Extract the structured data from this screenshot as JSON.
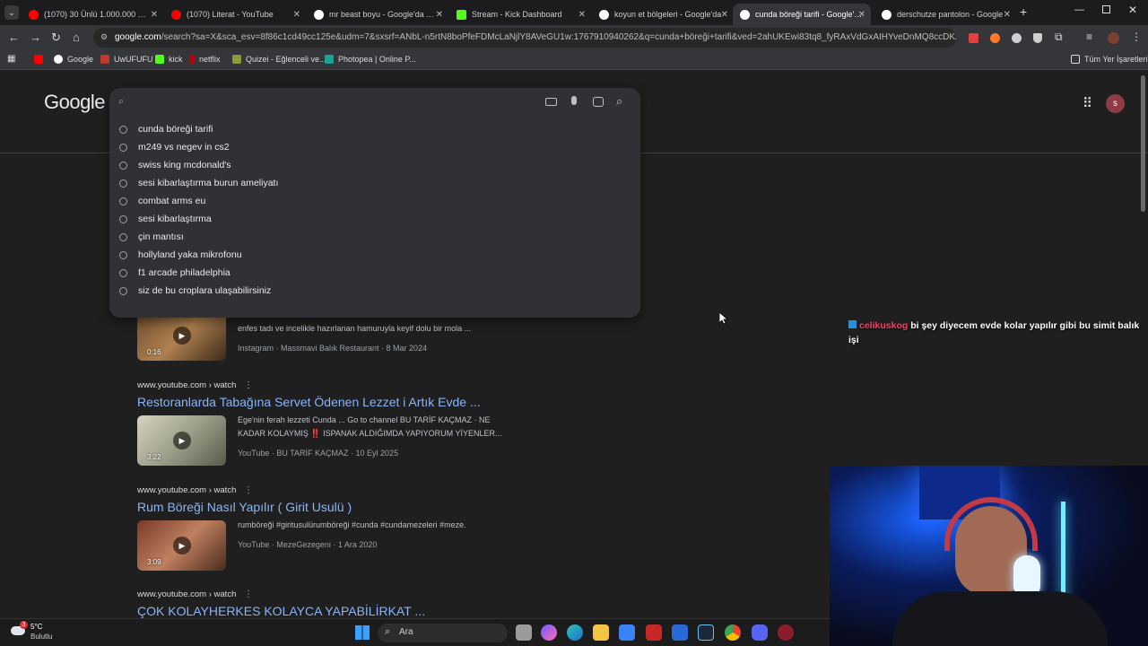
{
  "tabs": [
    {
      "label": "(1070) 30 Ünlü 1.000.000 Dolar",
      "icon": "youtube-icon",
      "active": false
    },
    {
      "label": "(1070) Literat - YouTube",
      "icon": "youtube-icon",
      "active": false
    },
    {
      "label": "mr beast boyu - Google'da Ara",
      "icon": "google-icon",
      "active": false
    },
    {
      "label": "Stream - Kick Dashboard",
      "icon": "kick-icon",
      "active": false
    },
    {
      "label": "koyun et bölgeleri - Google'da",
      "icon": "google-icon",
      "active": false
    },
    {
      "label": "cunda böreği tarifi - Google'da",
      "icon": "google-icon",
      "active": true
    },
    {
      "label": "derschutze pantolon - Google",
      "icon": "google-icon",
      "active": false
    }
  ],
  "omnibox": {
    "host": "google.com",
    "path": "/search?sa=X&sca_esv=8f86c1cd49cc125e&udm=7&sxsrf=ANbL-n5rtN8boPfeFDMcLaNjlY8AVeGU1w:1767910940262&q=cunda+böreği+tarifi&ved=2ahUKEwi83tq8_fyRAxVdGxAIHYveDnMQ8ccDKAJ6BAga..."
  },
  "bookmarks": [
    {
      "label": "",
      "icon": "youtube-icon"
    },
    {
      "label": "Google",
      "icon": "google-icon"
    },
    {
      "label": "UwUFUFU",
      "icon": "uwufufu-icon"
    },
    {
      "label": "kick",
      "icon": "kick-icon"
    },
    {
      "label": "netflix",
      "icon": "netflix-icon"
    },
    {
      "label": "Quizei - Eğlenceli ve...",
      "icon": "quizei-icon"
    },
    {
      "label": "Photopea | Online P...",
      "icon": "photopea-icon"
    }
  ],
  "bookmarks_all": "Tüm Yer İşaretleri",
  "logo": "Google",
  "avatar_letter": "s",
  "search": {
    "value": "",
    "placeholder": ""
  },
  "suggestions": [
    "cunda böreği tarifi",
    "m249 vs negev in cs2",
    "swiss king mcdonald's",
    "sesi kibarlaştırma burun ameliyatı",
    "combat arms eu",
    "sesi kibarlaştırma",
    "çin mantısı",
    "hollyland yaka mikrofonu",
    "f1 arcade philadelphia",
    "siz de bu croplara ulaşabilirsiniz"
  ],
  "results": [
    {
      "cite": "",
      "title": "",
      "snippet": "enfes tadı ve incelikle hazırlanan hamuruyla keyif dolu bir mola ...",
      "meta": "Instagram · Massmavi Balık Restaurant · 8 Mar 2024",
      "duration": "0:16"
    },
    {
      "cite": "www.youtube.com › watch",
      "title": "Restoranlarda Tabağına Servet Ödenen Lezzet i Artık Evde ...",
      "snippet": "Ege'nin ferah lezzeti Cunda ... Go to channel BU TARİF KAÇMAZ · NE KADAR KOLAYMIŞ ‼️ ISPANAK ALDIĞIMDA YAPIYORUM YİYENLER...",
      "meta": "YouTube · BU TARİF KAÇMAZ · 10 Eyl 2025",
      "duration": "3:22"
    },
    {
      "cite": "www.youtube.com › watch",
      "title": "Rum Böreği Nasıl Yapılır ( Girit Usulü )",
      "snippet": "rumböreği #giritusulürumböreği #cunda #cundamezeleri #meze.",
      "meta": "YouTube · MezeGezegeni · 1 Ara 2020",
      "duration": "3:09"
    },
    {
      "cite": "www.youtube.com › watch",
      "title": "ÇOK KOLAYHERKES KOLAYCA YAPABİLİRKAT ...",
      "snippet": "",
      "meta": "",
      "duration": ""
    }
  ],
  "chat": {
    "user": "celikuskog",
    "message": "bi şey diyecem evde kolar yapılır gibi bu simit balık işi"
  },
  "weather": {
    "temp": "5°C",
    "desc": "Bulutlu",
    "badge": "3"
  },
  "taskbar": {
    "search_placeholder": "Ara"
  },
  "colors": {
    "link": "#8ab4f8",
    "chat_user": "#ff3b6b",
    "page_bg": "#1f1f1f"
  }
}
